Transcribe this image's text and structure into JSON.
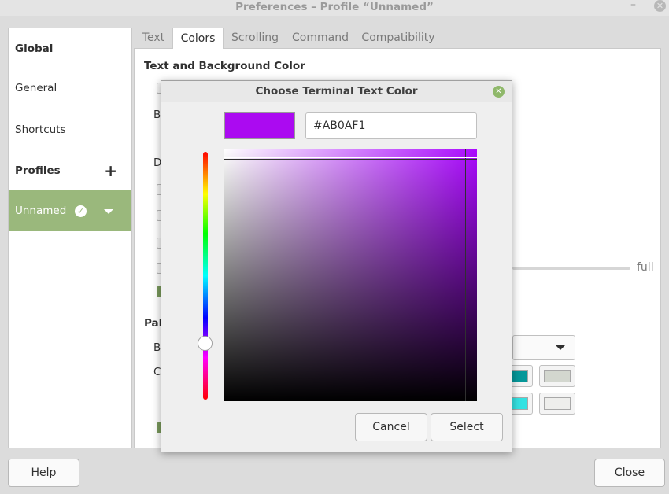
{
  "window": {
    "title": "Preferences – Profile “Unnamed”"
  },
  "sidebar": {
    "global_label": "Global",
    "general_label": "General",
    "shortcuts_label": "Shortcuts",
    "profiles_label": "Profiles",
    "profile_name": "Unnamed"
  },
  "tabs": [
    "Text",
    "Colors",
    "Scrolling",
    "Command",
    "Compatibility"
  ],
  "content": {
    "section_title": "Text and Background Color",
    "full_label": "full",
    "partial_labels": [
      "B",
      "D",
      "Pal",
      "B",
      "C"
    ]
  },
  "footer": {
    "help_label": "Help",
    "close_label": "Close"
  },
  "dialog": {
    "title": "Choose Terminal Text Color",
    "hex_value": "#AB0AF1",
    "cancel_label": "Cancel",
    "select_label": "Select",
    "selected_color": "#AB0AF1"
  },
  "colors": {
    "accent": "#9ab87c",
    "palette_swatches": [
      "#06989a",
      "#d3d7cf",
      "#34e2e2",
      "#eeeeec"
    ]
  }
}
